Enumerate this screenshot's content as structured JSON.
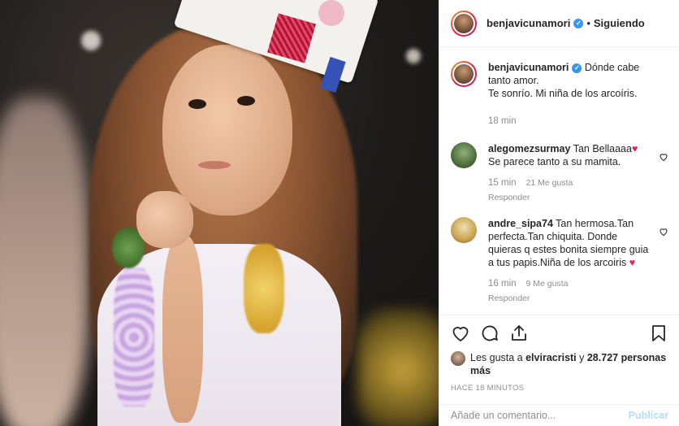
{
  "post": {
    "author": "benjavicunamori",
    "follow_separator": "•",
    "follow_status": "Siguiendo",
    "caption_lines": [
      "Dónde cabe tanto amor.",
      "Te sonrío. Mi niña de los arcoíris."
    ],
    "caption_time": "18 min"
  },
  "comments": [
    {
      "user": "alegomezsurmay",
      "text": "Tan Bellaaaa",
      "text_line2": "Se parece tanto a su mamita.",
      "time": "15 min",
      "likes": "21 Me gusta",
      "reply": "Responder"
    },
    {
      "user": "andre_sipa74",
      "text": "Tan hermosa.Tan perfecta.Tan chiquita. Donde quieras q estes bonita siempre guia a tus papis.Niña de los arcoiris",
      "time": "16 min",
      "likes": "9 Me gusta",
      "reply": "Responder"
    }
  ],
  "likes_summary": {
    "prefix": "Les gusta a ",
    "first_user": "elviracristi",
    "connector": " y ",
    "count": "28.727 personas más"
  },
  "time_ago": "HACE 18 MINUTOS",
  "comment_box": {
    "placeholder": "Añade un comentario...",
    "publish_label": "Publicar"
  },
  "icons": {
    "verified": "verified-badge-icon",
    "like": "heart-icon",
    "comment": "speech-bubble-icon",
    "share": "share-icon",
    "save": "bookmark-icon",
    "comment_like": "small-heart-icon"
  },
  "colors": {
    "verified": "#3897f0",
    "publish_disabled": "#b2dffc",
    "muted_text": "#8e8e8e",
    "emoji_heart": "#e0245e"
  }
}
